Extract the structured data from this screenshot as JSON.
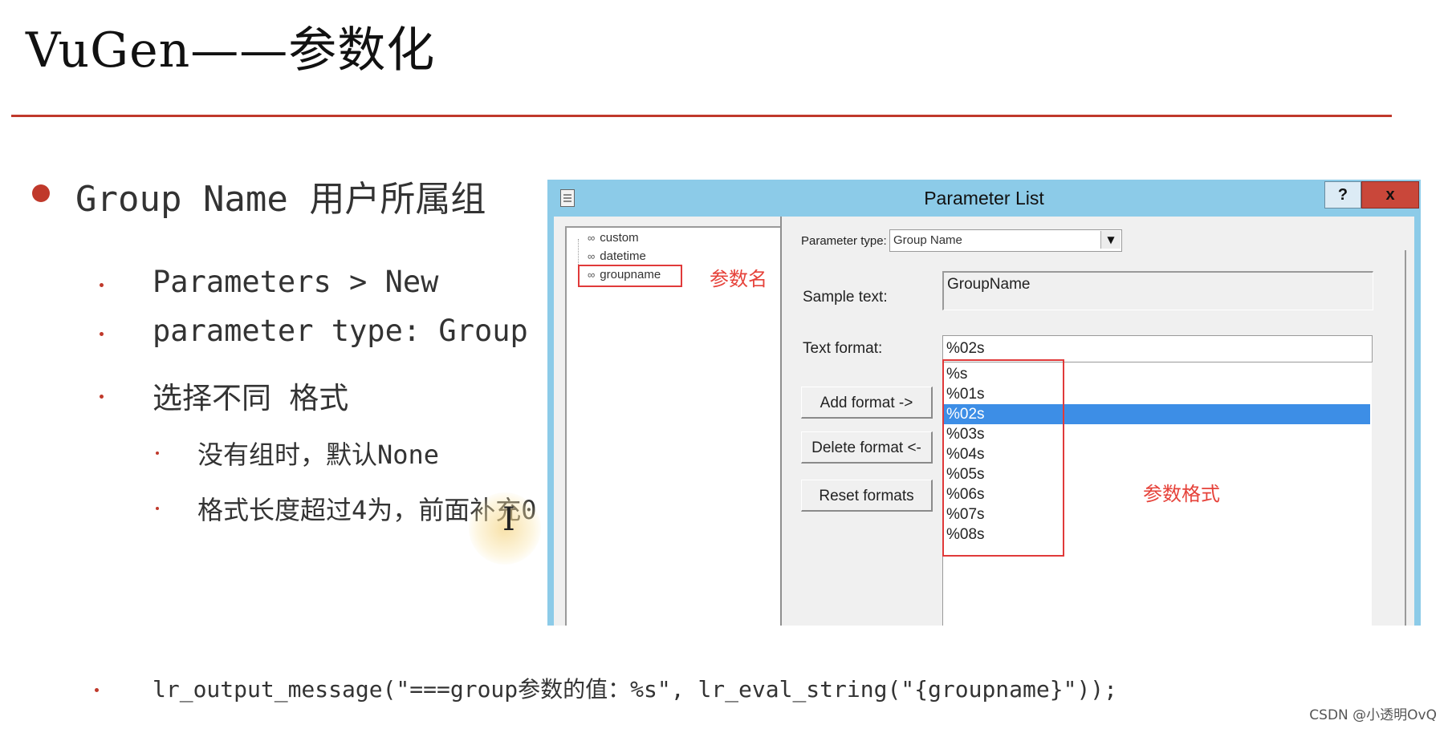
{
  "slide": {
    "title": "VuGen——参数化",
    "bullet_main": "Group Name 用户所属组",
    "sub_bullets": [
      "Parameters > New",
      "parameter type: Group Name",
      "选择不同 格式"
    ],
    "sub_sub_bullets": [
      "没有组时，默认None",
      "格式长度超过4为，前面补充0"
    ],
    "code_line": "lr_output_message(\"===group参数的值：%s\", lr_eval_string(\"{groupname}\"));",
    "watermark": "CSDN @小透明OvQ",
    "accent_color": "#c0392b"
  },
  "dialog": {
    "title": "Parameter List",
    "help_label": "?",
    "close_label": "x",
    "titlebar_color": "#8ccbe8",
    "tree_items": [
      {
        "icon": "parameter-icon",
        "label": "custom"
      },
      {
        "icon": "parameter-icon",
        "label": "datetime"
      },
      {
        "icon": "parameter-icon",
        "label": "groupname"
      }
    ],
    "annotation_param_name": "参数名",
    "annotation_param_format": "参数格式",
    "parameter_type_label": "Parameter type:",
    "parameter_type_value": "Group Name",
    "sample_text_label": "Sample text:",
    "sample_text_value": "GroupName",
    "text_format_label": "Text format:",
    "text_format_value": "%02s",
    "format_options": [
      "%s",
      "%01s",
      "%02s",
      "%03s",
      "%04s",
      "%05s",
      "%06s",
      "%07s",
      "%08s"
    ],
    "selected_format": "%02s",
    "selection_color": "#3d8ee6",
    "buttons": {
      "add": "Add format ->",
      "delete": "Delete format <-",
      "reset": "Reset formats"
    }
  }
}
